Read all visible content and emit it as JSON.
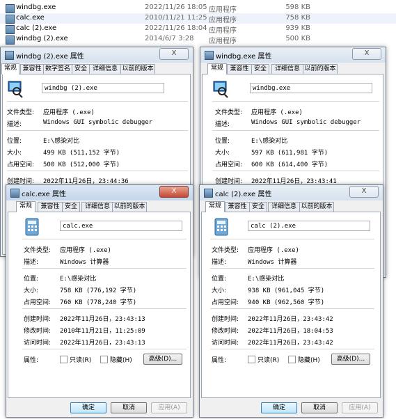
{
  "explorer": {
    "files": [
      {
        "name": "windbg.exe",
        "date": "2022/11/26 18:05",
        "type": "应用程序",
        "size": "598 KB"
      },
      {
        "name": "calc.exe",
        "date": "2010/11/21 11:25",
        "type": "应用程序",
        "size": "758 KB"
      },
      {
        "name": "calc (2).exe",
        "date": "2022/11/26 18:04",
        "type": "应用程序",
        "size": "939 KB"
      },
      {
        "name": "windbg (2).exe",
        "date": "2014/6/7 3:28",
        "type": "应用程序",
        "size": "500 KB"
      }
    ]
  },
  "labels": {
    "file_type": "文件类型:",
    "description": "描述:",
    "location": "位置:",
    "size": "大小:",
    "size_on_disk": "占用空间:",
    "created": "创建时间:",
    "modified": "修改时间:",
    "accessed": "访问时间:",
    "attributes": "属性:",
    "readonly": "只读(R)",
    "hidden": "隐藏(H)",
    "advanced": "高级(D)...",
    "ok": "确定",
    "cancel": "取消",
    "apply": "应用(A)",
    "close": "X"
  },
  "dialogs": {
    "windbg2": {
      "title": "windbg (2).exe 属性",
      "tabs": [
        "常规",
        "兼容性",
        "数字签名",
        "安全",
        "详细信息",
        "以前的版本"
      ],
      "filename": "windbg (2).exe",
      "file_type": "应用程序 (.exe)",
      "description": "Windows GUI symbolic debugger",
      "location": "E:\\感染对比",
      "size": "499 KB (511,152 字节)",
      "size_on_disk": "500 KB (512,000 字节)",
      "created": "2022年11月26日，23:44:36"
    },
    "windbg": {
      "title": "windbg.exe 属性",
      "tabs": [
        "常规",
        "兼容性",
        "安全",
        "详细信息",
        "以前的版本"
      ],
      "filename": "windbg.exe",
      "file_type": "应用程序 (.exe)",
      "description": "Windows GUI symbolic debugger",
      "location": "E:\\感染对比",
      "size": "597 KB (611,981 字节)",
      "size_on_disk": "600 KB (614,400 字节)",
      "created": "2022年11月26日，23:43:41"
    },
    "calc": {
      "title": "calc.exe 属性",
      "tabs": [
        "常规",
        "兼容性",
        "安全",
        "详细信息",
        "以前的版本"
      ],
      "filename": "calc.exe",
      "file_type": "应用程序 (.exe)",
      "description": "Windows 计算器",
      "location": "E:\\感染对比",
      "size": "758 KB (776,192 字节)",
      "size_on_disk": "760 KB (778,240 字节)",
      "created": "2022年11月26日，23:43:13",
      "modified": "2010年11月21日，11:25:09",
      "accessed": "2022年11月26日，23:43:13"
    },
    "calc2": {
      "title": "calc (2).exe 属性",
      "tabs": [
        "常规",
        "兼容性",
        "安全",
        "详细信息",
        "以前的版本"
      ],
      "filename": "calc (2).exe",
      "file_type": "应用程序 (.exe)",
      "description": "Windows 计算器",
      "location": "E:\\感染对比",
      "size": "938 KB (961,045 字节)",
      "size_on_disk": "940 KB (962,560 字节)",
      "created": "2022年11月26日，23:43:42",
      "modified": "2022年11月26日，18:04:53",
      "accessed": "2022年11月26日，23:43:42"
    }
  }
}
